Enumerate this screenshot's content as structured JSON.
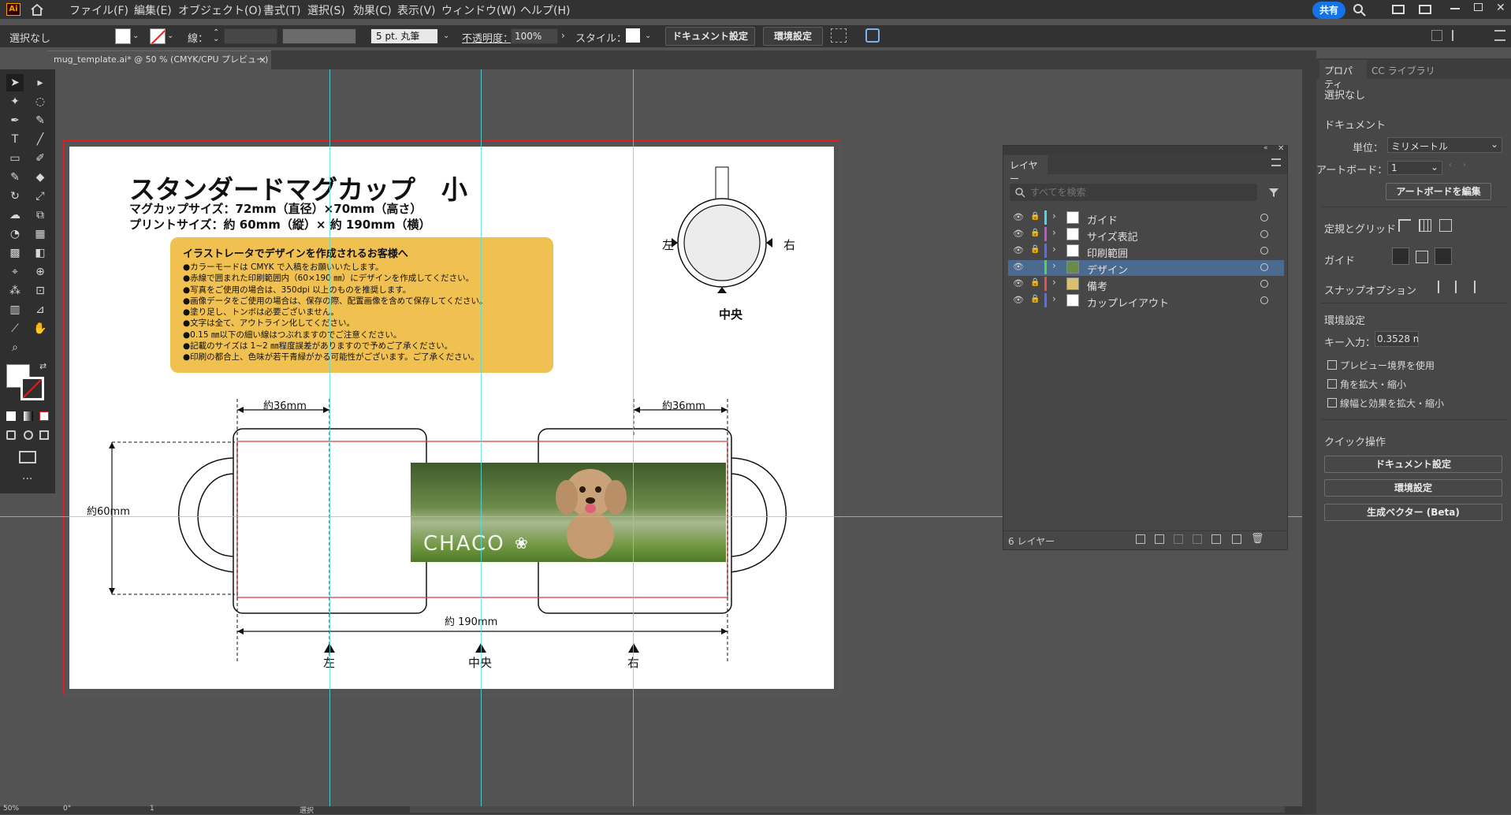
{
  "menubar": {
    "items": [
      "ファイル(F)",
      "編集(E)",
      "オブジェクト(O)",
      "書式(T)",
      "選択(S)",
      "効果(C)",
      "表示(V)",
      "ウィンドウ(W)",
      "ヘルプ(H)"
    ],
    "logo": "Ai",
    "share_label": "共有"
  },
  "controlbar": {
    "selection": "選択なし",
    "stroke_label": "線：",
    "stroke_profile": "5 pt. 丸筆",
    "opacity_label": "不透明度：",
    "opacity_value": "100%",
    "style_label": "スタイル：",
    "doc_settings": "ドキュメント設定",
    "prefs": "環境設定"
  },
  "tab": {
    "title": "mug_template.ai* @ 50 % (CMYK/CPU プレビュー)",
    "close": "×"
  },
  "artboard": {
    "title": "スタンダードマグカップ　小",
    "line1": "マグカップサイズ：72mm（直径）×70mm（高さ）",
    "line2": "プリントサイズ：約 60mm（縦）× 約 190mm（横）",
    "notice_title": "イラストレータでデザインを作成されるお客様へ",
    "notice_items": [
      "●カラーモードは CMYK で入稿をお願いいたします。",
      "●赤線で囲まれた印刷範囲内（60×190 ㎜）にデザインを作成してください。",
      "●写真をご使用の場合は、350dpi 以上のものを推奨します。",
      "●画像データをご使用の場合は、保存の際、配置画像を含めて保存してください。",
      "●塗り足し、トンボは必要ございません。",
      "●文字は全て、アウトライン化してください。",
      "●0.15 ㎜以下の細い線はつぶれますのでご注意ください。",
      "●記載のサイズは 1~2 ㎜程度誤差がありますので予めご了承ください。",
      "●印刷の都合上、色味が若干青緑がかる可能性がございます。ご了承ください。"
    ],
    "top_left": "左",
    "top_right": "右",
    "top_center": "中央",
    "dim_left": "約36mm",
    "dim_right": "約36mm",
    "dim_height": "約60mm",
    "dim_width": "約 190mm",
    "bottom_left": "左",
    "bottom_center": "中央",
    "bottom_right": "右",
    "photo_text": "CHACO"
  },
  "layers_panel": {
    "tab": "レイヤー",
    "search_placeholder": "すべてを検索",
    "layers": [
      {
        "name": "ガイド",
        "color": "#4ad8e8"
      },
      {
        "name": "サイズ表記",
        "color": "#c84fd8"
      },
      {
        "name": "印刷範囲",
        "color": "#5a6cf0"
      },
      {
        "name": "デザイン",
        "color": "#4fd84f"
      },
      {
        "name": "備考",
        "color": "#e84f4f"
      },
      {
        "name": "カップレイアウト",
        "color": "#5a6cf0"
      }
    ],
    "footer": "6 レイヤー"
  },
  "properties_panel": {
    "tab1": "プロパティ",
    "tab2": "CC ライブラリ",
    "selection": "選択なし",
    "document": "ドキュメント",
    "unit_label": "単位：",
    "unit_value": "ミリメートル",
    "artboard_label": "アートボード：",
    "artboard_value": "1",
    "edit_artboard": "アートボードを編集",
    "rulers_grid": "定規とグリッド",
    "guides": "ガイド",
    "snap": "スナップオプション",
    "prefs": "環境設定",
    "key_label": "キー入力：",
    "key_value": "0.3528 m",
    "cb1": "プレビュー境界を使用",
    "cb2": "角を拡大・縮小",
    "cb3": "線幅と効果を拡大・縮小",
    "quick": "クイック操作",
    "btn1": "ドキュメント設定",
    "btn2": "環境設定",
    "btn3": "生成ベクター (Beta)"
  },
  "status": {
    "zoom": "50%",
    "rotate": "0°",
    "page": "1",
    "mode": "選択"
  }
}
